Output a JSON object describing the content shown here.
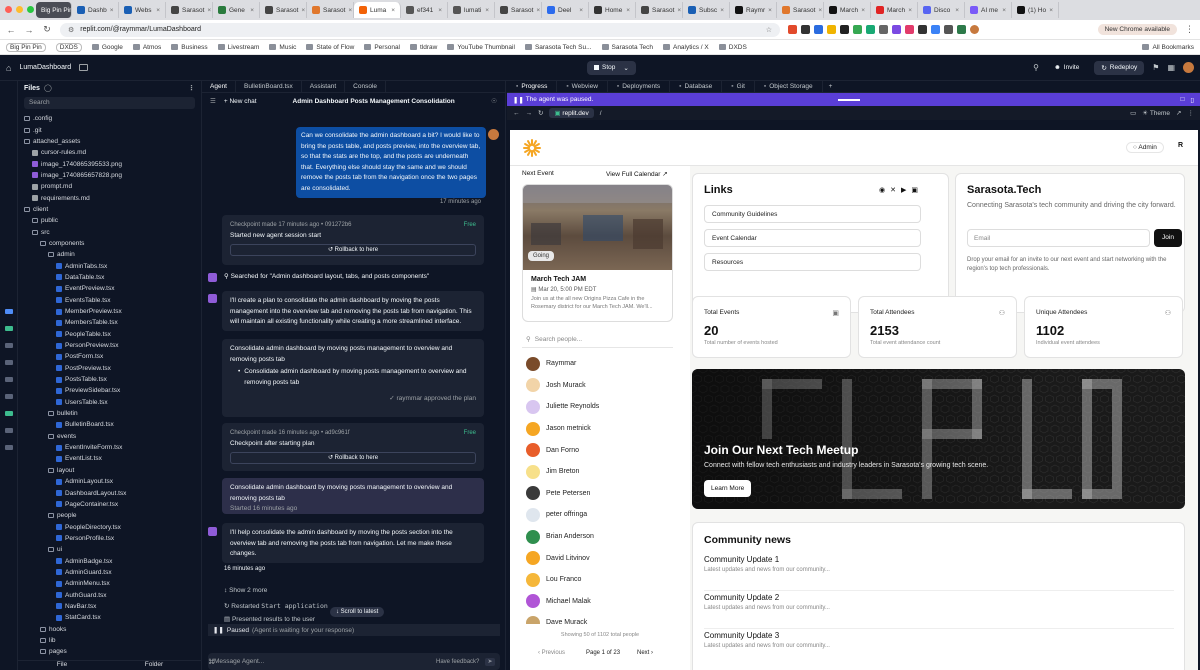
{
  "browser": {
    "tabs": [
      {
        "label": "Big Pin Pin",
        "color": "#4a4d55"
      },
      {
        "label": "Dashb",
        "color": "#1a5fb4"
      },
      {
        "label": "Webs",
        "color": "#1a5fb4"
      },
      {
        "label": "Sarasot",
        "color": "#444"
      },
      {
        "label": "Gene",
        "color": "#2a7b3d"
      },
      {
        "label": "Sarasot",
        "color": "#444"
      },
      {
        "label": "Sarasot",
        "color": "#e0772c"
      },
      {
        "label": "Luma",
        "color": "#f26207"
      },
      {
        "label": "ef341",
        "color": "#555"
      },
      {
        "label": "lumati",
        "color": "#555"
      },
      {
        "label": "Sarasot",
        "color": "#444"
      },
      {
        "label": "Deel",
        "color": "#2c6bed"
      },
      {
        "label": "Home",
        "color": "#333"
      },
      {
        "label": "Sarasot",
        "color": "#444"
      },
      {
        "label": "Subsc",
        "color": "#1a5fb4"
      },
      {
        "label": "Raymr",
        "color": "#111"
      },
      {
        "label": "Sarasot",
        "color": "#e0772c"
      },
      {
        "label": "March",
        "color": "#111"
      },
      {
        "label": "March",
        "color": "#e02424"
      },
      {
        "label": "Disco",
        "color": "#5865f2"
      },
      {
        "label": "AI me",
        "color": "#7a5af8"
      },
      {
        "label": "(1) Ho",
        "color": "#111"
      }
    ],
    "url": "replit.com/@raymmar/LumaDashboard",
    "new_chrome": "New Chrome available",
    "bookmarks": [
      "Big Pin Pin",
      "DXDS",
      "Google",
      "Atmos",
      "Business",
      "Livestream",
      "Music",
      "State of Flow",
      "Personal",
      "tldraw",
      "YouTube Thumbnail",
      "Sarasota Tech Su...",
      "Sarasota Tech",
      "Analytics / X",
      "DXDS"
    ],
    "all_bookmarks": "All Bookmarks"
  },
  "replit": {
    "project": "LumaDashboard",
    "stop": "Stop",
    "invite": "Invite",
    "redeploy": "Redeploy"
  },
  "files": {
    "title": "Files",
    "search": "Search",
    "items": [
      {
        "name": ".config",
        "depth": 0,
        "kind": "folder"
      },
      {
        "name": ".git",
        "depth": 0,
        "kind": "folder"
      },
      {
        "name": "attached_assets",
        "depth": 0,
        "kind": "folder"
      },
      {
        "name": "cursor-rules.md",
        "depth": 1,
        "kind": "md"
      },
      {
        "name": "image_1740865395533.png",
        "depth": 1,
        "kind": "img"
      },
      {
        "name": "image_1740865657828.png",
        "depth": 1,
        "kind": "img"
      },
      {
        "name": "prompt.md",
        "depth": 1,
        "kind": "md"
      },
      {
        "name": "requirements.md",
        "depth": 1,
        "kind": "md"
      },
      {
        "name": "client",
        "depth": 0,
        "kind": "folder"
      },
      {
        "name": "public",
        "depth": 1,
        "kind": "folder"
      },
      {
        "name": "src",
        "depth": 1,
        "kind": "folder"
      },
      {
        "name": "components",
        "depth": 2,
        "kind": "folder"
      },
      {
        "name": "admin",
        "depth": 3,
        "kind": "folder"
      },
      {
        "name": "AdminTabs.tsx",
        "depth": 4,
        "kind": "file"
      },
      {
        "name": "DataTable.tsx",
        "depth": 4,
        "kind": "file"
      },
      {
        "name": "EventPreview.tsx",
        "depth": 4,
        "kind": "file"
      },
      {
        "name": "EventsTable.tsx",
        "depth": 4,
        "kind": "file"
      },
      {
        "name": "MemberPreview.tsx",
        "depth": 4,
        "kind": "file"
      },
      {
        "name": "MembersTable.tsx",
        "depth": 4,
        "kind": "file"
      },
      {
        "name": "PeopleTable.tsx",
        "depth": 4,
        "kind": "file"
      },
      {
        "name": "PersonPreview.tsx",
        "depth": 4,
        "kind": "file"
      },
      {
        "name": "PostForm.tsx",
        "depth": 4,
        "kind": "file"
      },
      {
        "name": "PostPreview.tsx",
        "depth": 4,
        "kind": "file"
      },
      {
        "name": "PostsTable.tsx",
        "depth": 4,
        "kind": "file"
      },
      {
        "name": "PreviewSidebar.tsx",
        "depth": 4,
        "kind": "file"
      },
      {
        "name": "UsersTable.tsx",
        "depth": 4,
        "kind": "file"
      },
      {
        "name": "bulletin",
        "depth": 3,
        "kind": "folder"
      },
      {
        "name": "BulletinBoard.tsx",
        "depth": 4,
        "kind": "file"
      },
      {
        "name": "events",
        "depth": 3,
        "kind": "folder"
      },
      {
        "name": "EventInviteForm.tsx",
        "depth": 4,
        "kind": "file"
      },
      {
        "name": "EventList.tsx",
        "depth": 4,
        "kind": "file"
      },
      {
        "name": "layout",
        "depth": 3,
        "kind": "folder"
      },
      {
        "name": "AdminLayout.tsx",
        "depth": 4,
        "kind": "file"
      },
      {
        "name": "DashboardLayout.tsx",
        "depth": 4,
        "kind": "file"
      },
      {
        "name": "PageContainer.tsx",
        "depth": 4,
        "kind": "file"
      },
      {
        "name": "people",
        "depth": 3,
        "kind": "folder"
      },
      {
        "name": "PeopleDirectory.tsx",
        "depth": 4,
        "kind": "file"
      },
      {
        "name": "PersonProfile.tsx",
        "depth": 4,
        "kind": "file"
      },
      {
        "name": "ui",
        "depth": 3,
        "kind": "folder"
      },
      {
        "name": "AdminBadge.tsx",
        "depth": 4,
        "kind": "file"
      },
      {
        "name": "AdminGuard.tsx",
        "depth": 4,
        "kind": "file"
      },
      {
        "name": "AdminMenu.tsx",
        "depth": 4,
        "kind": "file"
      },
      {
        "name": "AuthGuard.tsx",
        "depth": 4,
        "kind": "file"
      },
      {
        "name": "NavBar.tsx",
        "depth": 4,
        "kind": "file"
      },
      {
        "name": "StatCard.tsx",
        "depth": 4,
        "kind": "file"
      },
      {
        "name": "hooks",
        "depth": 2,
        "kind": "folder"
      },
      {
        "name": "lib",
        "depth": 2,
        "kind": "folder"
      },
      {
        "name": "pages",
        "depth": 2,
        "kind": "folder"
      }
    ],
    "new_file": "File",
    "new_folder": "Folder"
  },
  "agent": {
    "tabs": [
      "Agent",
      "BulletinBoard.tsx",
      "Assistant",
      "Console"
    ],
    "new_chat": "New chat",
    "chat_title": "Admin Dashboard Posts Management Consolidation",
    "user_message": "Can we consolidate the admin dashboard a bit? I would like to bring the posts table, and posts preview, into the overview tab, so that the stats are the top, and the posts are underneath that. Everything else should stay the same and we should remove the posts tab from the navigation once the two pages are consolidated.",
    "user_time": "17 minutes ago",
    "checkpoint1_meta": "Checkpoint made 17 minutes ago • 091272b6",
    "checkpoint1_free": "Free",
    "checkpoint1_title": "Started new agent session start",
    "rollback": "Rollback to here",
    "search_line": "Searched for \"Admin dashboard layout, tabs, and posts components\"",
    "plan_text": "I'll create a plan to consolidate the admin dashboard by moving the posts management into the overview tab and removing the posts tab from navigation. This will maintain all existing functionality while creating a more streamlined interface.",
    "plan_title": "Consolidate admin dashboard by moving posts management to overview and removing posts tab",
    "plan_bullet": "Consolidate admin dashboard by moving posts management to overview and removing posts tab",
    "plan_approved": "raymmar approved the plan",
    "checkpoint2_meta": "Checkpoint made 16 minutes ago • ad9c961f",
    "checkpoint2_free": "Free",
    "checkpoint2_title": "Checkpoint after starting plan",
    "task_title": "Consolidate admin dashboard by moving posts management to overview and removing posts tab",
    "task_started": "Started 16 minutes ago",
    "help_text": "I'll help consolidate the admin dashboard by moving the posts section into the overview tab and removing the posts tab from navigation. Let me make these changes.",
    "help_time": "16 minutes ago",
    "show_more": "Show 2 more",
    "restarted": "Restarted",
    "restarted_code": "Start application",
    "presented": "Presented results to the user",
    "scroll_latest": "Scroll to latest",
    "paused": "Paused",
    "paused_note": "(Agent is waiting for your response)",
    "input_placeholder": "Message Agent...",
    "feedback": "Have feedback?"
  },
  "panel": {
    "tabs": [
      "Progress",
      "Webview",
      "Deployments",
      "Database",
      "Git",
      "Object Storage"
    ],
    "paused_banner": "The agent was paused.",
    "webview_url": "replit.dev",
    "webview_path": "/",
    "theme": "Theme"
  },
  "site": {
    "accent": "#f5a623",
    "admin": "Admin",
    "user_initial": "R",
    "next_event": "Next Event",
    "view_calendar": "View Full Calendar",
    "going": "Going",
    "event_title": "March Tech JAM",
    "event_date": "Mar 20, 5:00 PM EDT",
    "event_desc": "Join us at the all new Origins Pizza Cafe in the Rosemary district for our March Tech JAM. We'll...",
    "search_people": "Search people...",
    "people": [
      {
        "name": "Raymmar",
        "color": "#7a4b2a"
      },
      {
        "name": "Josh Murack",
        "color": "#f2d4a8"
      },
      {
        "name": "Juliette Reynolds",
        "color": "#d8c6f0"
      },
      {
        "name": "Jason metnick",
        "color": "#f5a623"
      },
      {
        "name": "Dan Forno",
        "color": "#e85d2a"
      },
      {
        "name": "Jim Breton",
        "color": "#f7e08a"
      },
      {
        "name": "Pete Petersen",
        "color": "#3a3a3a"
      },
      {
        "name": "peter offringa",
        "color": "#dfe6ee"
      },
      {
        "name": "Brian Anderson",
        "color": "#2f8f4e"
      },
      {
        "name": "David Litvinov",
        "color": "#f5a623"
      },
      {
        "name": "Lou Franco",
        "color": "#f5b73a"
      },
      {
        "name": "Michael Malak",
        "color": "#b055d6"
      },
      {
        "name": "Dave Murack",
        "color": "#c9a46a"
      }
    ],
    "showing": "Showing 50 of 1102 total people",
    "previous": "Previous",
    "page_of": "Page 1 of 23",
    "next": "Next",
    "links_title": "Links",
    "links": [
      "Community Guidelines",
      "Event Calendar",
      "Resources"
    ],
    "org_title": "Sarasota.Tech",
    "org_desc": "Connecting Sarasota's tech community and driving the city forward.",
    "email_placeholder": "Email",
    "join": "Join",
    "org_note": "Drop your email for an invite to our next event and start networking with the region's top tech professionals.",
    "stats": [
      {
        "label": "Total Events",
        "value": "20",
        "sub": "Total number of events hosted"
      },
      {
        "label": "Total Attendees",
        "value": "2153",
        "sub": "Total event attendance count"
      },
      {
        "label": "Unique Attendees",
        "value": "1102",
        "sub": "Individual event attendees"
      }
    ],
    "hero_title": "Join Our Next Tech Meetup",
    "hero_sub": "Connect with fellow tech enthusiasts and industry leaders in Sarasota's growing tech scene.",
    "learn_more": "Learn More",
    "news_title": "Community news",
    "news": [
      {
        "title": "Community Update 1",
        "sub": "Latest updates and news from our community..."
      },
      {
        "title": "Community Update 2",
        "sub": "Latest updates and news from our community..."
      },
      {
        "title": "Community Update 3",
        "sub": "Latest updates and news from our community..."
      }
    ]
  }
}
